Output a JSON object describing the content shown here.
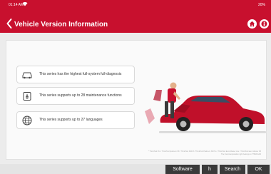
{
  "status": {
    "time": "01:14 AM",
    "battery": "20%"
  },
  "header": {
    "title": "Vehicle Version Information"
  },
  "features": [
    {
      "icon": "car-icon",
      "text": "This series has the highest full-system full-diagnosis"
    },
    {
      "icon": "maintenance-icon",
      "text": "This series supports up to 28 maintenance functions"
    },
    {
      "icon": "globe-icon",
      "text": "This series supports up to 27 languages"
    }
  ],
  "disclaimer": {
    "line1": "* ThinkTool Pro / ThinkTool platinum S8 / ThinkTool PAD 8 / ThinkTool Platinum S8 Pro / ThinkTool Euro Master Lite / ThinkTool Euro Master S8",
    "line2": "The final interpretation right belongs to THINKCAR"
  },
  "softkeys": {
    "software": "Software",
    "h": "h",
    "search": "Search",
    "ok": "OK"
  },
  "colors": {
    "brand": "#c8102e",
    "softkey_bg": "#3a3a3a"
  }
}
